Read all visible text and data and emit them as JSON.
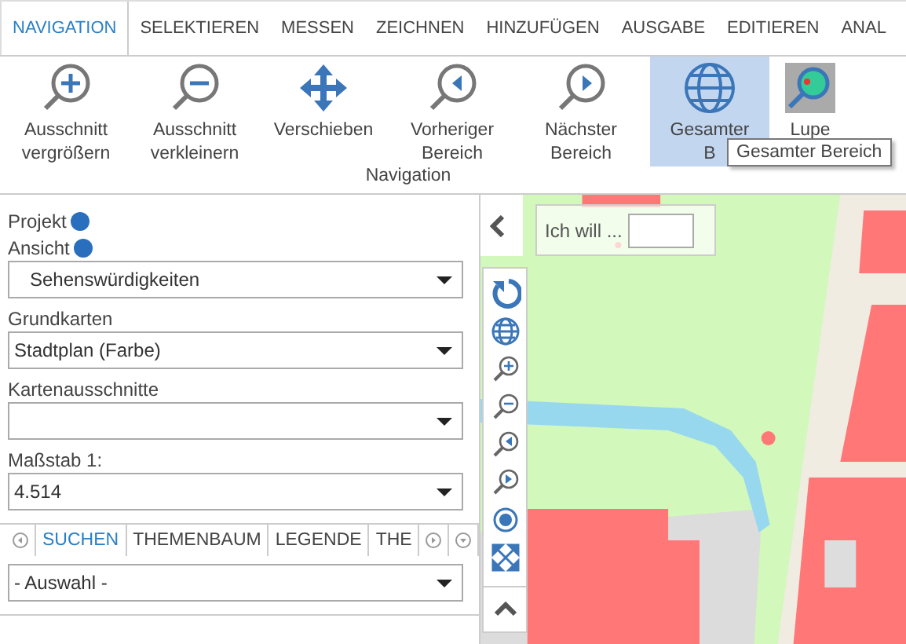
{
  "tabs": [
    {
      "label": "NAVIGATION",
      "selected": true
    },
    {
      "label": "SELEKTIEREN",
      "selected": false
    },
    {
      "label": "MESSEN",
      "selected": false
    },
    {
      "label": "ZEICHNEN",
      "selected": false
    },
    {
      "label": "HINZUFÜGEN",
      "selected": false
    },
    {
      "label": "AUSGABE",
      "selected": false
    },
    {
      "label": "EDITIEREN",
      "selected": false
    },
    {
      "label": "ANAL",
      "selected": false
    }
  ],
  "ribbon": {
    "buttons": [
      {
        "kind": "zoom-in",
        "lines": [
          "Ausschnitt",
          "vergrößern"
        ],
        "selected": false
      },
      {
        "kind": "zoom-out",
        "lines": [
          "Ausschnitt",
          "verkleinern"
        ],
        "selected": false
      },
      {
        "kind": "pan",
        "lines": [
          "Verschieben"
        ],
        "selected": false
      },
      {
        "kind": "previous",
        "lines": [
          "Vorheriger",
          "Bereich"
        ],
        "selected": false
      },
      {
        "kind": "next",
        "lines": [
          "Nächster",
          "Bereich"
        ],
        "selected": false
      },
      {
        "kind": "globe",
        "lines": [
          "Gesamter",
          "B"
        ],
        "selected": true
      },
      {
        "kind": "magnifier",
        "lines": [
          "Lupe"
        ],
        "selected": false
      }
    ],
    "group_label": "Navigation",
    "tooltip": "Gesamter Bereich"
  },
  "panel": {
    "projekt": "Projekt",
    "ansicht_label": "Ansicht",
    "ansicht": "Sehenswürdigkeiten",
    "fields": [
      {
        "label": "Grundkarten",
        "value": "Stadtplan (Farbe)"
      },
      {
        "label": "Kartenausschnitte"
      },
      {
        "label": "Maßstab 1:",
        "value": "4.514"
      }
    ],
    "tabs": [
      {
        "label": "SUCHEN",
        "selected": true
      },
      {
        "label": "THEMENBAUM",
        "selected": false
      },
      {
        "label": "LEGENDE",
        "selected": false
      },
      {
        "label": "THE",
        "selected": false
      }
    ],
    "search_select": "- Auswahl -"
  },
  "map": {
    "search_label": "Ich will ...",
    "tools": [
      {
        "kind": "refresh"
      },
      {
        "kind": "globe"
      },
      {
        "kind": "zoom-in"
      },
      {
        "kind": "zoom-out"
      },
      {
        "kind": "previous"
      },
      {
        "kind": "next"
      },
      {
        "kind": "locate"
      },
      {
        "kind": "fullscreen"
      }
    ]
  }
}
